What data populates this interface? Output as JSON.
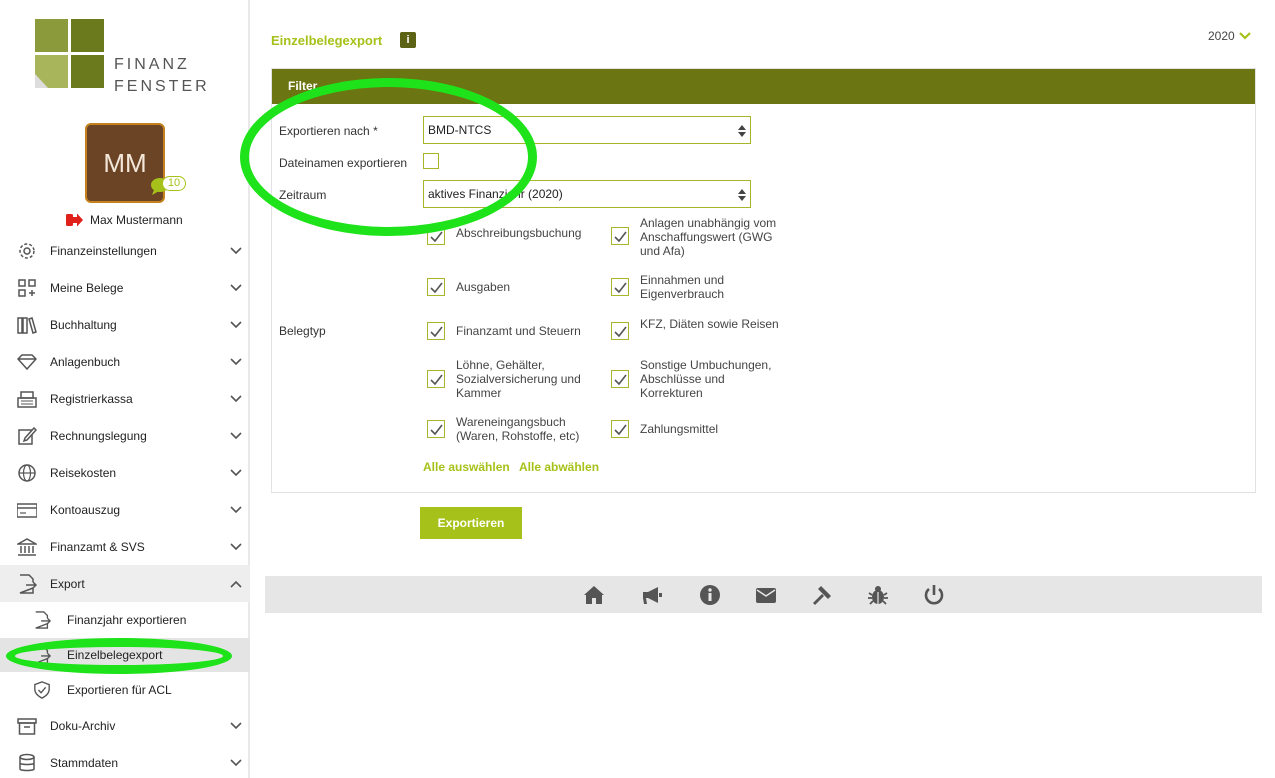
{
  "logo": {
    "line1": "FINANZ",
    "line2": "FENSTER"
  },
  "user": {
    "initials": "MM",
    "message_count": "10",
    "name": "Max Mustermann"
  },
  "sidebar": {
    "items": [
      {
        "label": "Finanzeinstellungen",
        "icon": "gear-icon"
      },
      {
        "label": "Meine Belege",
        "icon": "grid-icon"
      },
      {
        "label": "Buchhaltung",
        "icon": "books-icon"
      },
      {
        "label": "Anlagenbuch",
        "icon": "diamond-icon"
      },
      {
        "label": "Registrierkassa",
        "icon": "cash-register-icon"
      },
      {
        "label": "Rechnungslegung",
        "icon": "edit-icon"
      },
      {
        "label": "Reisekosten",
        "icon": "globe-icon"
      },
      {
        "label": "Kontoauszug",
        "icon": "card-icon"
      },
      {
        "label": "Finanzamt & SVS",
        "icon": "bank-icon"
      },
      {
        "label": "Export",
        "icon": "file-export-icon"
      },
      {
        "label": "Doku-Archiv",
        "icon": "archive-icon"
      },
      {
        "label": "Stammdaten",
        "icon": "database-icon"
      }
    ],
    "export_sub": [
      {
        "label": "Finanzjahr exportieren",
        "icon": "file-export-icon"
      },
      {
        "label": "Einzelbelegexport",
        "icon": "file-export-icon"
      },
      {
        "label": "Exportieren für ACL",
        "icon": "shield-check-icon"
      }
    ]
  },
  "header": {
    "title": "Einzelbelegexport",
    "info": "i",
    "year": "2020"
  },
  "filter": {
    "title": "Filter",
    "export_to_label": "Exportieren nach",
    "required_mark": "*",
    "export_to_value": "BMD-NTCS",
    "filenames_label": "Dateinamen exportieren",
    "filenames_checked": false,
    "period_label": "Zeitraum",
    "period_value": "aktives Finanzjahr (2020)",
    "belegtyp_label": "Belegtyp",
    "belegtypes": [
      {
        "label": "Abschreibungsbuchung",
        "checked": true
      },
      {
        "label": "Anlagen unabhängig vom Anschaffungswert (GWG und Afa)",
        "checked": true
      },
      {
        "label": "Ausgaben",
        "checked": true
      },
      {
        "label": "Einnahmen und Eigenverbrauch",
        "checked": true
      },
      {
        "label": "Finanzamt und Steuern",
        "checked": true
      },
      {
        "label": "KFZ, Diäten sowie Reisen",
        "checked": true
      },
      {
        "label": "Löhne, Gehälter, Sozialversicherung und Kammer",
        "checked": true
      },
      {
        "label": "Sonstige Umbuchungen, Abschlüsse und Korrekturen",
        "checked": true
      },
      {
        "label": "Wareneingangsbuch (Waren, Rohstoffe, etc)",
        "checked": true
      },
      {
        "label": "Zahlungsmittel",
        "checked": true
      }
    ],
    "select_all": "Alle auswählen",
    "deselect_all": "Alle abwählen"
  },
  "export_button": "Exportieren",
  "footer_icons": [
    "home-icon",
    "megaphone-icon",
    "info-icon",
    "mail-icon",
    "gavel-icon",
    "bug-icon",
    "power-icon"
  ],
  "colors": {
    "accent": "#a6c21a",
    "header": "#6b7511",
    "highlight": "#1ee31a",
    "avatar_bg": "#6b4426"
  }
}
